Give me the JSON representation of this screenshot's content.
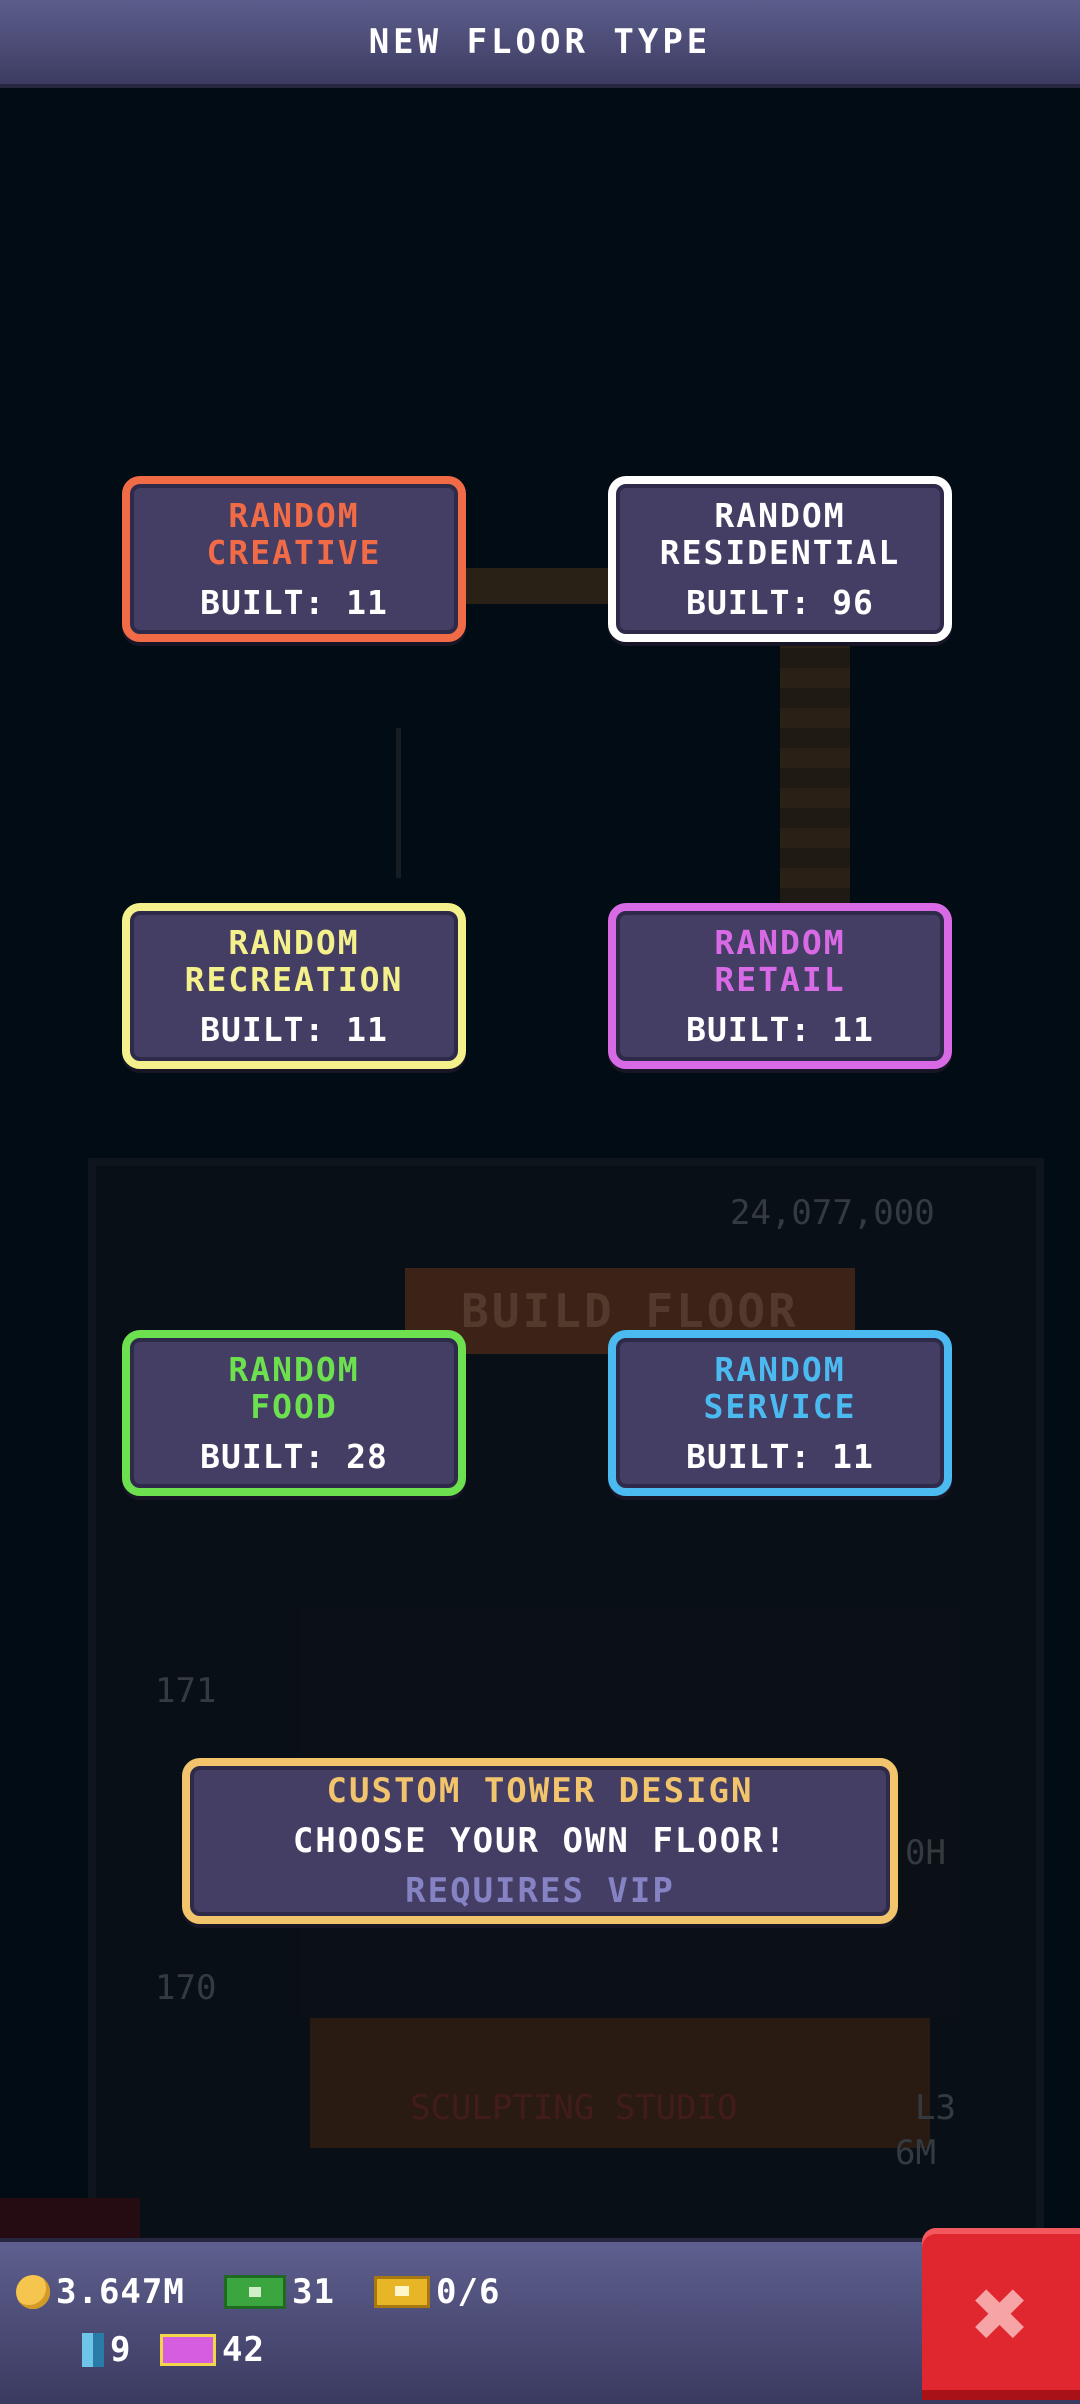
{
  "header": {
    "title": "NEW FLOOR TYPE"
  },
  "background": {
    "sign": "BUILD FLOOR",
    "cost": "24,077,000",
    "floor_a": "171",
    "floor_b": "170",
    "shop": "SCULPTING STUDIO",
    "level": "L3",
    "time": "0H",
    "money": "6M"
  },
  "floor_types": [
    {
      "name_line1": "RANDOM",
      "name_line2": "CREATIVE",
      "built": "BUILT: 11",
      "color": "#f26b47"
    },
    {
      "name_line1": "RANDOM",
      "name_line2": "RESIDENTIAL",
      "built": "BUILT: 96",
      "color": "#ffffff"
    },
    {
      "name_line1": "RANDOM",
      "name_line2": "RECREATION",
      "built": "BUILT: 11",
      "color": "#f4f08c"
    },
    {
      "name_line1": "RANDOM",
      "name_line2": "RETAIL",
      "built": "BUILT: 11",
      "color": "#d96ae6"
    },
    {
      "name_line1": "RANDOM",
      "name_line2": "FOOD",
      "built": "BUILT: 28",
      "color": "#6de04f"
    },
    {
      "name_line1": "RANDOM",
      "name_line2": "SERVICE",
      "built": "BUILT: 11",
      "color": "#4bbaf0"
    }
  ],
  "custom": {
    "title": "CUSTOM TOWER DESIGN",
    "subtitle": "CHOOSE YOUR OWN FLOOR!",
    "requirement": "REQUIRES VIP"
  },
  "footer": {
    "coins": "3.647M",
    "bux": "31",
    "tickets": "0/6",
    "elevator": "9",
    "vip_tickets": "42"
  },
  "icons": {
    "close": "close-icon",
    "coin": "coin-icon",
    "bux": "bux-icon",
    "ticket": "ticket-icon",
    "elevator": "elevator-icon",
    "vip": "vip-ticket-icon"
  }
}
